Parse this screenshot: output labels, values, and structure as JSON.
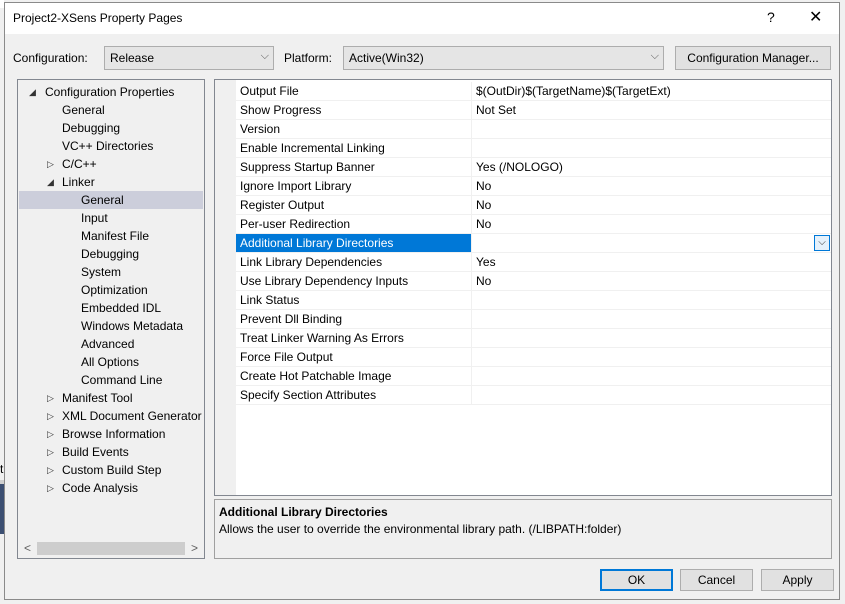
{
  "window": {
    "title": "Project2-XSens Property Pages",
    "help_glyph": "?",
    "close_glyph": "✕"
  },
  "toolbar": {
    "configuration_label": "Configuration:",
    "configuration_value": "Release",
    "platform_label": "Platform:",
    "platform_value": "Active(Win32)",
    "configuration_manager_label": "Configuration Manager...",
    "chevron_glyph": "⌵"
  },
  "tree": {
    "items": [
      {
        "label": "Configuration Properties",
        "level": 0,
        "state": "expanded",
        "selected": false
      },
      {
        "label": "General",
        "level": 1,
        "state": "leaf",
        "selected": false
      },
      {
        "label": "Debugging",
        "level": 1,
        "state": "leaf",
        "selected": false
      },
      {
        "label": "VC++ Directories",
        "level": 1,
        "state": "leaf",
        "selected": false
      },
      {
        "label": "C/C++",
        "level": 1,
        "state": "collapsed",
        "selected": false
      },
      {
        "label": "Linker",
        "level": 1,
        "state": "expanded",
        "selected": false
      },
      {
        "label": "General",
        "level": 2,
        "state": "leaf",
        "selected": true
      },
      {
        "label": "Input",
        "level": 2,
        "state": "leaf",
        "selected": false
      },
      {
        "label": "Manifest File",
        "level": 2,
        "state": "leaf",
        "selected": false
      },
      {
        "label": "Debugging",
        "level": 2,
        "state": "leaf",
        "selected": false
      },
      {
        "label": "System",
        "level": 2,
        "state": "leaf",
        "selected": false
      },
      {
        "label": "Optimization",
        "level": 2,
        "state": "leaf",
        "selected": false
      },
      {
        "label": "Embedded IDL",
        "level": 2,
        "state": "leaf",
        "selected": false
      },
      {
        "label": "Windows Metadata",
        "level": 2,
        "state": "leaf",
        "selected": false
      },
      {
        "label": "Advanced",
        "level": 2,
        "state": "leaf",
        "selected": false
      },
      {
        "label": "All Options",
        "level": 2,
        "state": "leaf",
        "selected": false
      },
      {
        "label": "Command Line",
        "level": 2,
        "state": "leaf",
        "selected": false
      },
      {
        "label": "Manifest Tool",
        "level": 1,
        "state": "collapsed",
        "selected": false
      },
      {
        "label": "XML Document Generator",
        "level": 1,
        "state": "collapsed",
        "selected": false
      },
      {
        "label": "Browse Information",
        "level": 1,
        "state": "collapsed",
        "selected": false
      },
      {
        "label": "Build Events",
        "level": 1,
        "state": "collapsed",
        "selected": false
      },
      {
        "label": "Custom Build Step",
        "level": 1,
        "state": "collapsed",
        "selected": false
      },
      {
        "label": "Code Analysis",
        "level": 1,
        "state": "collapsed",
        "selected": false
      }
    ],
    "scroll_left_glyph": "<",
    "scroll_right_glyph": ">"
  },
  "grid": {
    "rows": [
      {
        "name": "Output File",
        "value": "$(OutDir)$(TargetName)$(TargetExt)"
      },
      {
        "name": "Show Progress",
        "value": "Not Set"
      },
      {
        "name": "Version",
        "value": ""
      },
      {
        "name": "Enable Incremental Linking",
        "value": ""
      },
      {
        "name": "Suppress Startup Banner",
        "value": "Yes (/NOLOGO)"
      },
      {
        "name": "Ignore Import Library",
        "value": "No"
      },
      {
        "name": "Register Output",
        "value": "No"
      },
      {
        "name": "Per-user Redirection",
        "value": "No"
      },
      {
        "name": "Additional Library Directories",
        "value": "",
        "selected": true
      },
      {
        "name": "Link Library Dependencies",
        "value": "Yes"
      },
      {
        "name": "Use Library Dependency Inputs",
        "value": "No"
      },
      {
        "name": "Link Status",
        "value": ""
      },
      {
        "name": "Prevent Dll Binding",
        "value": ""
      },
      {
        "name": "Treat Linker Warning As Errors",
        "value": ""
      },
      {
        "name": "Force File Output",
        "value": ""
      },
      {
        "name": "Create Hot Patchable Image",
        "value": ""
      },
      {
        "name": "Specify Section Attributes",
        "value": ""
      }
    ],
    "dropdown_glyph": "⌵"
  },
  "description": {
    "title": "Additional Library Directories",
    "text": "Allows the user to override the environmental library path. (/LIBPATH:folder)"
  },
  "buttons": {
    "ok": "OK",
    "cancel": "Cancel",
    "apply": "Apply"
  },
  "background": {
    "partial_text": "t"
  },
  "colors": {
    "selection_accent": "#0078d7",
    "tree_selection": "#cccedb"
  }
}
